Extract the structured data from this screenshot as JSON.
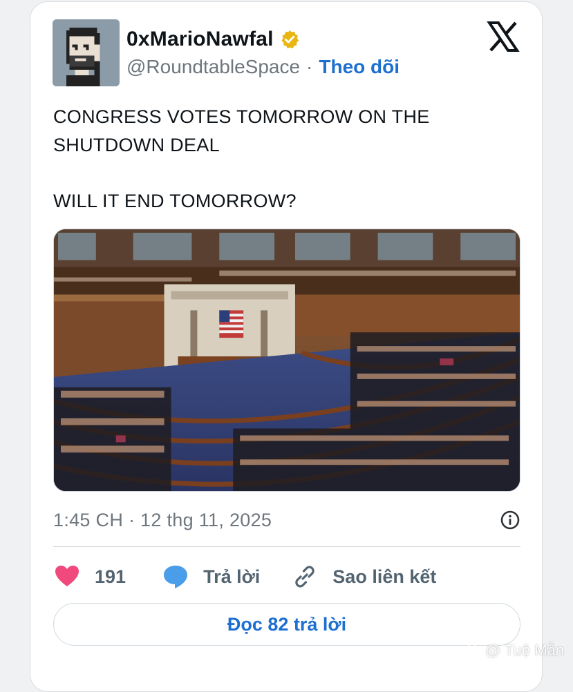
{
  "author": {
    "display_name": "0xMarioNawfal",
    "handle": "@RoundtableSpace",
    "separator": "·",
    "follow_label": "Theo dõi",
    "verified_color": "#e8b511"
  },
  "brand": {
    "logo": "x-logo-icon"
  },
  "tweet": {
    "lines": [
      "CONGRESS VOTES TOMORROW ON THE",
      "SHUTDOWN DEAL",
      "WILL IT END TOMORROW?"
    ],
    "media_description_icon": "photo"
  },
  "meta": {
    "timestamp": "1:45 CH · 12 thg 11, 2025",
    "info_icon": "info-icon"
  },
  "actions": {
    "like_count": "191",
    "reply_label": "Trả lời",
    "copy_link_label": "Sao liên kết"
  },
  "read_replies_label": "Đọc 82 trả lời",
  "watermark": {
    "text": "@ Tuệ Mẫn"
  },
  "colors": {
    "accent_blue": "#1d6fd1",
    "like_pink": "#f0497e",
    "reply_blue": "#4a9de8",
    "muted_text": "#6e767d"
  }
}
